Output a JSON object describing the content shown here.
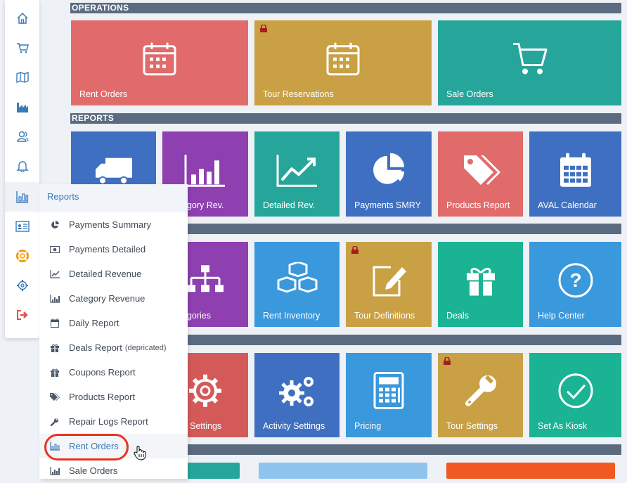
{
  "sections": {
    "operations": "OPERATIONS",
    "reports": "REPORTS"
  },
  "operations_tiles": [
    {
      "label": "Rent Orders",
      "color": "#e16b6b",
      "icon": "calendar-icon",
      "locked": false
    },
    {
      "label": "Tour Reservations",
      "color": "#c9a043",
      "icon": "calendar-icon",
      "locked": true
    },
    {
      "label": "Sale Orders",
      "color": "#26a69a",
      "icon": "cart-icon",
      "locked": false
    }
  ],
  "reports_tiles": [
    {
      "label": "",
      "color": "#3f6fc0",
      "icon": "truck-icon"
    },
    {
      "label": "egory Rev.",
      "color": "#8e3fb0",
      "icon": "bar-chart-icon"
    },
    {
      "label": "Detailed Rev.",
      "color": "#26a69a",
      "icon": "trend-chart-icon"
    },
    {
      "label": "Payments SMRY",
      "color": "#3f6fc0",
      "icon": "pie-chart-icon"
    },
    {
      "label": "Products Report",
      "color": "#e16b6b",
      "icon": "tags-icon"
    },
    {
      "label": "AVAL Calendar",
      "color": "#3f6fc0",
      "icon": "calendar-grid-icon"
    }
  ],
  "row3_tiles": [
    {
      "label": "egories",
      "color": "#8e3fb0",
      "icon": "hierarchy-icon",
      "locked": false
    },
    {
      "label": "Rent Inventory",
      "color": "#3a98dc",
      "icon": "cubes-icon",
      "locked": false
    },
    {
      "label": "Tour Definitions",
      "color": "#c9a043",
      "icon": "edit-icon",
      "locked": true
    },
    {
      "label": "Deals",
      "color": "#1ab394",
      "icon": "gift-icon",
      "locked": false
    },
    {
      "label": "Help Center",
      "color": "#3a98dc",
      "icon": "help-icon",
      "locked": false
    }
  ],
  "row4_tiles": [
    {
      "label": "Settings",
      "color": "#d45a5a",
      "icon": "gear-icon",
      "locked": false
    },
    {
      "label": "Activity Settings",
      "color": "#3f6fc0",
      "icon": "gears-icon",
      "locked": false
    },
    {
      "label": "Pricing",
      "color": "#3a98dc",
      "icon": "calculator-icon",
      "locked": false
    },
    {
      "label": "Tour Settings",
      "color": "#c9a043",
      "icon": "wrench-icon",
      "locked": true
    },
    {
      "label": "Set As Kiosk",
      "color": "#1ab394",
      "icon": "check-circle-icon",
      "locked": false
    }
  ],
  "sidebar_icons": [
    "home-icon",
    "cart-icon",
    "map-icon",
    "factory-icon",
    "users-icon",
    "bell-icon",
    "reports-icon",
    "id-card-icon",
    "lifebuoy-icon",
    "settings-icon",
    "logout-icon"
  ],
  "dropdown": {
    "title": "Reports",
    "items": [
      {
        "label": "Payments Summary",
        "note": "",
        "icon": "pie-icon"
      },
      {
        "label": "Payments Detailed",
        "note": "",
        "icon": "money-icon"
      },
      {
        "label": "Detailed Revenue",
        "note": "",
        "icon": "line-chart-icon"
      },
      {
        "label": "Category Revenue",
        "note": "",
        "icon": "bar-chart-icon"
      },
      {
        "label": "Daily Report",
        "note": "",
        "icon": "calendar-icon"
      },
      {
        "label": "Deals Report",
        "note": "(depricated)",
        "icon": "gift-icon"
      },
      {
        "label": "Coupons Report",
        "note": "",
        "icon": "gift-icon"
      },
      {
        "label": "Products Report",
        "note": "",
        "icon": "tags-icon"
      },
      {
        "label": "Repair Logs Report",
        "note": "",
        "icon": "wrench-icon"
      },
      {
        "label": "Rent Orders",
        "note": "",
        "icon": "bar-chart-icon"
      },
      {
        "label": "Sale Orders",
        "note": "",
        "icon": "bar-chart-icon"
      }
    ]
  },
  "colors": {
    "section_bar": "#5b6b80",
    "accent": "#3b7ab8",
    "highlight_circle": "#e8331f"
  }
}
